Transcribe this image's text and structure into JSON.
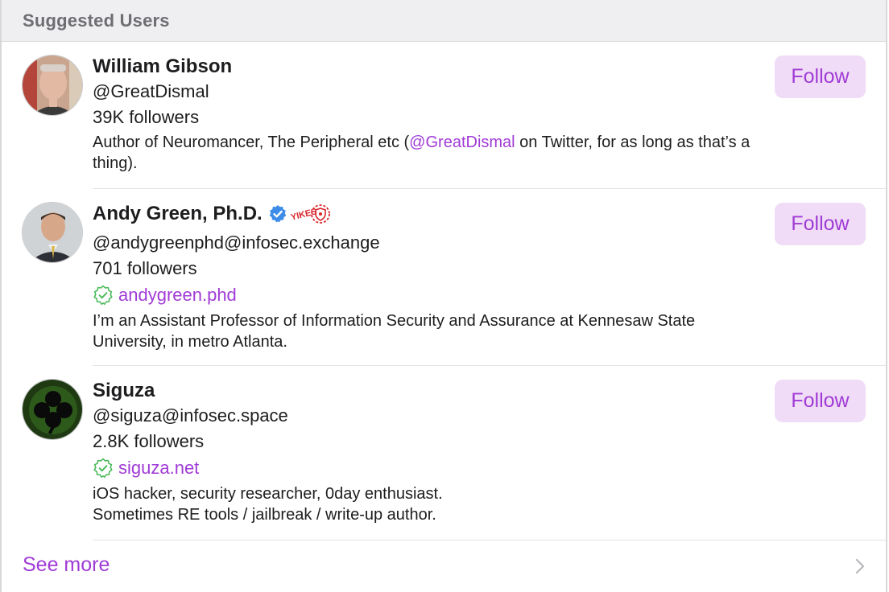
{
  "section": {
    "title": "Suggested Users"
  },
  "users": [
    {
      "name": "William Gibson",
      "handle": "@GreatDismal",
      "followers": "39K followers",
      "bio_before": "Author of Neuromancer, The Peripheral etc (",
      "bio_mention": "@GreatDismal",
      "bio_after": " on Twitter, for as long as that’s a thing).",
      "follow_label": "Follow"
    },
    {
      "name": "Andy Green, Ph.D.",
      "badge_text": "YIKES",
      "handle": "@andygreenphd@infosec.exchange",
      "followers": "701 followers",
      "link": "andygreen.phd",
      "bio": "I’m an Assistant Professor of Information Security and Assurance at Kennesaw State University, in metro Atlanta.",
      "follow_label": "Follow"
    },
    {
      "name": "Siguza",
      "handle": "@siguza@infosec.space",
      "followers": "2.8K followers",
      "link": "siguza.net",
      "bio_line1": "iOS hacker, security researcher, 0day enthusiast.",
      "bio_line2": "Sometimes RE tools / jailbreak / write-up author.",
      "follow_label": "Follow"
    }
  ],
  "footer": {
    "see_more_label": "See more"
  },
  "colors": {
    "accent": "#a03bd6",
    "button_bg": "#f0dcf6",
    "verified_blue": "#3d8de8",
    "link_check_green": "#4cba5a",
    "badge_red": "#d8262c"
  },
  "icons": {
    "verified": "verified-check-icon",
    "yikes": "yikes-badge-icon",
    "link_verified": "verified-link-icon",
    "chevron": "chevron-right-icon"
  }
}
